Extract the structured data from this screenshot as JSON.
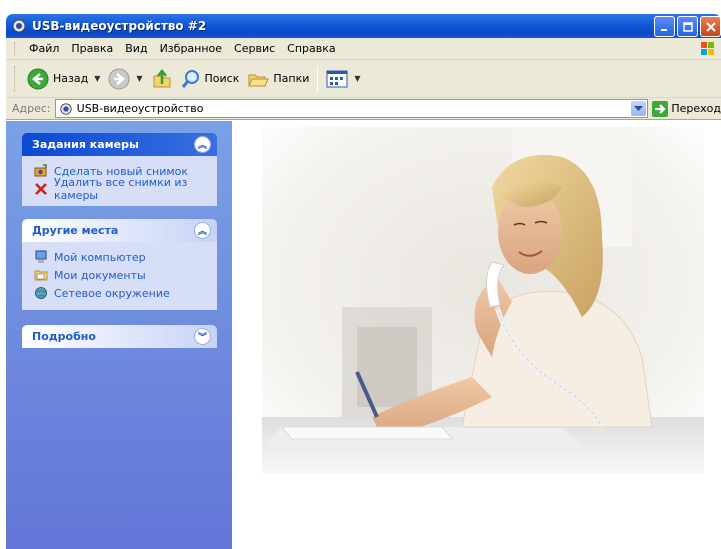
{
  "window": {
    "title": "USB-видеоустройство #2"
  },
  "menubar": {
    "items": [
      "Файл",
      "Правка",
      "Вид",
      "Избранное",
      "Сервис",
      "Справка"
    ]
  },
  "toolbar": {
    "back_label": "Назад",
    "search_label": "Поиск",
    "folders_label": "Папки"
  },
  "addressbar": {
    "label": "Адрес:",
    "value": "USB-видеоустройство",
    "go_label": "Переход"
  },
  "taskpane": {
    "camera_tasks": {
      "title": "Задания камеры",
      "items": [
        "Сделать новый снимок",
        "Удалить все снимки из камеры"
      ]
    },
    "other_places": {
      "title": "Другие места",
      "items": [
        "Мой компьютер",
        "Мои документы",
        "Сетевое окружение"
      ]
    },
    "details": {
      "title": "Подробно"
    }
  },
  "colors": {
    "titlebar": "#0a48c9",
    "taskpane_bg": "#6375d6",
    "link": "#215dc6"
  },
  "icons": {
    "title": "camera-icon",
    "back": "back-arrow-icon",
    "forward": "forward-arrow-icon",
    "up": "folder-up-icon",
    "search": "magnifier-icon",
    "folders": "folders-icon",
    "views": "views-icon",
    "go": "go-arrow-icon"
  }
}
